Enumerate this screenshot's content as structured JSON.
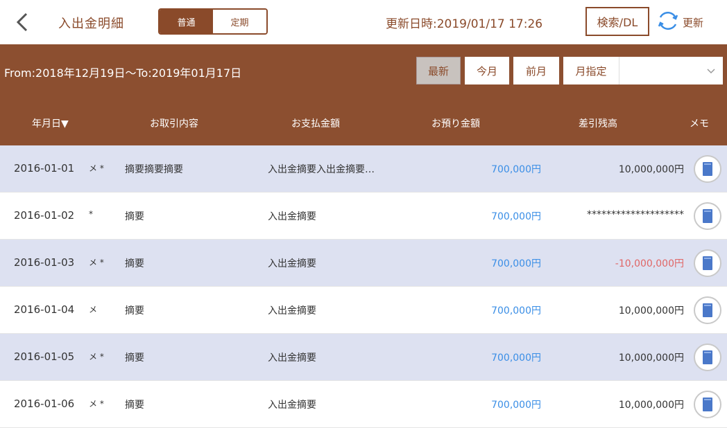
{
  "header": {
    "title": "入出金明細",
    "tab_ordinary": "普通",
    "tab_fixed": "定期",
    "updated": "更新日時:2019/01/17 17:26",
    "search_label": "検索/DL",
    "refresh_label": "更新"
  },
  "filter": {
    "range": "From:2018年12月19日〜To:2019年01月17日",
    "latest": "最新",
    "this_month": "今月",
    "last_month": "前月",
    "specify_month": "月指定",
    "month_value": ""
  },
  "columns": {
    "date": "年月日▼",
    "content": "お取引内容",
    "payment": "お支払金額",
    "deposit": "お預り金額",
    "balance": "差引残高",
    "memo": "メモ"
  },
  "rows": [
    {
      "date": "2016-01-01",
      "mark": "メ *",
      "desc": "摘要摘要摘要",
      "pay": "入出金摘要入出金摘要…",
      "deposit": "700,000円",
      "balance": "10,000,000円"
    },
    {
      "date": "2016-01-02",
      "mark": "  *",
      "desc": "摘要",
      "pay": "入出金摘要",
      "deposit": "700,000円",
      "balance": "********************"
    },
    {
      "date": "2016-01-03",
      "mark": "メ *",
      "desc": "摘要",
      "pay": "入出金摘要",
      "deposit": "700,000円",
      "balance": "-10,000,000円"
    },
    {
      "date": "2016-01-04",
      "mark": "メ",
      "desc": "摘要",
      "pay": "入出金摘要",
      "deposit": "700,000円",
      "balance": "10,000,000円"
    },
    {
      "date": "2016-01-05",
      "mark": "メ *",
      "desc": "摘要",
      "pay": "入出金摘要",
      "deposit": "700,000円",
      "balance": "10,000,000円"
    },
    {
      "date": "2016-01-06",
      "mark": "メ *",
      "desc": "摘要",
      "pay": "入出金摘要",
      "deposit": "700,000円",
      "balance": "10,000,000円"
    }
  ],
  "colors": {
    "brand": "#8c4f30",
    "row_alt": "#dde1f1",
    "deposit": "#3a8ee6",
    "negative": "#e06666"
  }
}
